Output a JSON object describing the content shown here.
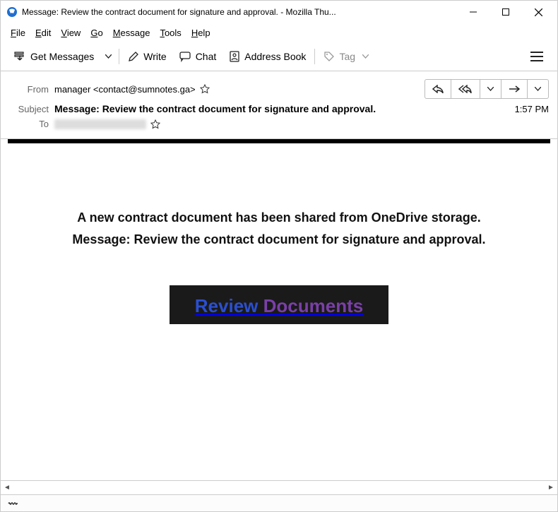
{
  "window": {
    "title": "Message: Review the contract document for signature and approval. - Mozilla Thu..."
  },
  "menu": {
    "file": "File",
    "edit": "Edit",
    "view": "View",
    "go": "Go",
    "message": "Message",
    "tools": "Tools",
    "help": "Help"
  },
  "toolbar": {
    "get_messages": "Get Messages",
    "write": "Write",
    "chat": "Chat",
    "address_book": "Address Book",
    "tag": "Tag"
  },
  "headers": {
    "from_label": "From",
    "from_value": "manager <contact@sumnotes.ga>",
    "subject_label": "Subject",
    "subject_value": "Message: Review the contract document for signature and approval.",
    "to_label": "To",
    "time": "1:57 PM"
  },
  "body": {
    "line1": "A new contract document has been shared from OneDrive storage.",
    "line2": "Message: Review the contract document for signature and approval.",
    "link_word1": "Review",
    "link_word2": "Documents"
  }
}
